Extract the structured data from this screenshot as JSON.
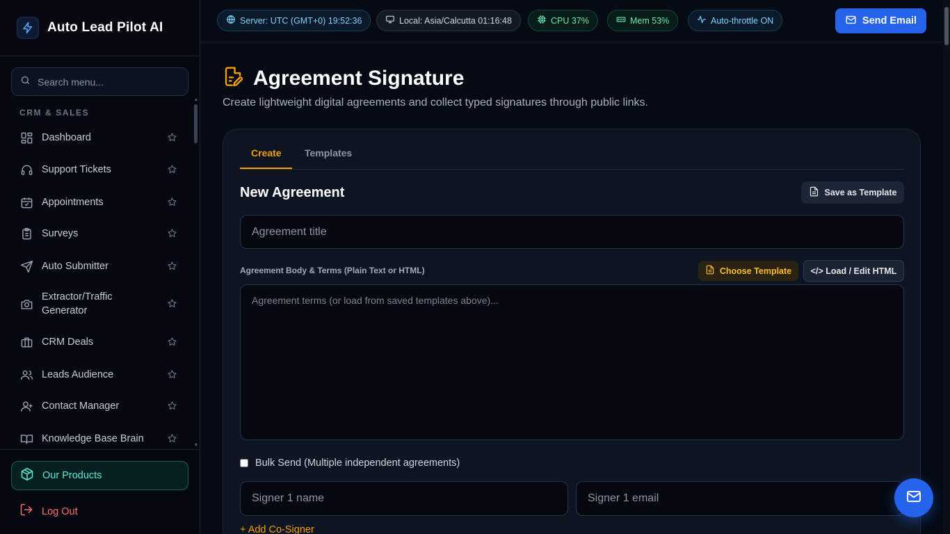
{
  "brand": {
    "name": "Auto Lead Pilot AI",
    "icon": "bolt-icon"
  },
  "search": {
    "placeholder": "Search menu..."
  },
  "sidebar": {
    "section_label": "CRM & SALES",
    "items": [
      {
        "label": "Dashboard",
        "icon": "grid-icon"
      },
      {
        "label": "Support Tickets",
        "icon": "headset-icon"
      },
      {
        "label": "Appointments",
        "icon": "calendar-check-icon"
      },
      {
        "label": "Surveys",
        "icon": "clipboard-icon"
      },
      {
        "label": "Auto Submitter",
        "icon": "send-icon"
      },
      {
        "label": "Extractor/Traffic Generator",
        "icon": "camera-icon"
      },
      {
        "label": "CRM Deals",
        "icon": "briefcase-icon"
      },
      {
        "label": "Leads Audience",
        "icon": "users-icon"
      },
      {
        "label": "Contact Manager",
        "icon": "contact-icon"
      },
      {
        "label": "Knowledge Base Brain",
        "icon": "book-icon"
      }
    ],
    "products_label": "Our Products",
    "logout_label": "Log Out"
  },
  "topbar": {
    "server": "Server: UTC (GMT+0) 19:52:36",
    "local": "Local: Asia/Calcutta 01:16:48",
    "cpu": "CPU 37%",
    "mem": "Mem 53%",
    "auto": "Auto-throttle ON",
    "send_label": "Send Email"
  },
  "page": {
    "title": "Agreement Signature",
    "subtitle": "Create lightweight digital agreements and collect typed signatures through public links."
  },
  "card": {
    "tabs": [
      "Create",
      "Templates"
    ],
    "active_tab": "Create",
    "title": "New Agreement",
    "save_template_label": "Save as Template",
    "title_placeholder": "Agreement title",
    "body_label": "Agreement Body & Terms (Plain Text or HTML)",
    "choose_template_label": "Choose Template",
    "load_html_label": "</> Load / Edit HTML",
    "body_placeholder": "Agreement terms (or load from saved templates above)...",
    "bulk_label": "Bulk Send (Multiple independent agreements)",
    "bulk_checked": false,
    "signer_name_placeholder": "Signer 1 name",
    "signer_email_placeholder": "Signer 1 email",
    "add_cosigner_label": "+ Add Co-Signer"
  },
  "colors": {
    "accent": "#f59e0b",
    "primary": "#2563eb",
    "teal": "#5eead4",
    "danger": "#f87171",
    "background": "#050a14"
  }
}
